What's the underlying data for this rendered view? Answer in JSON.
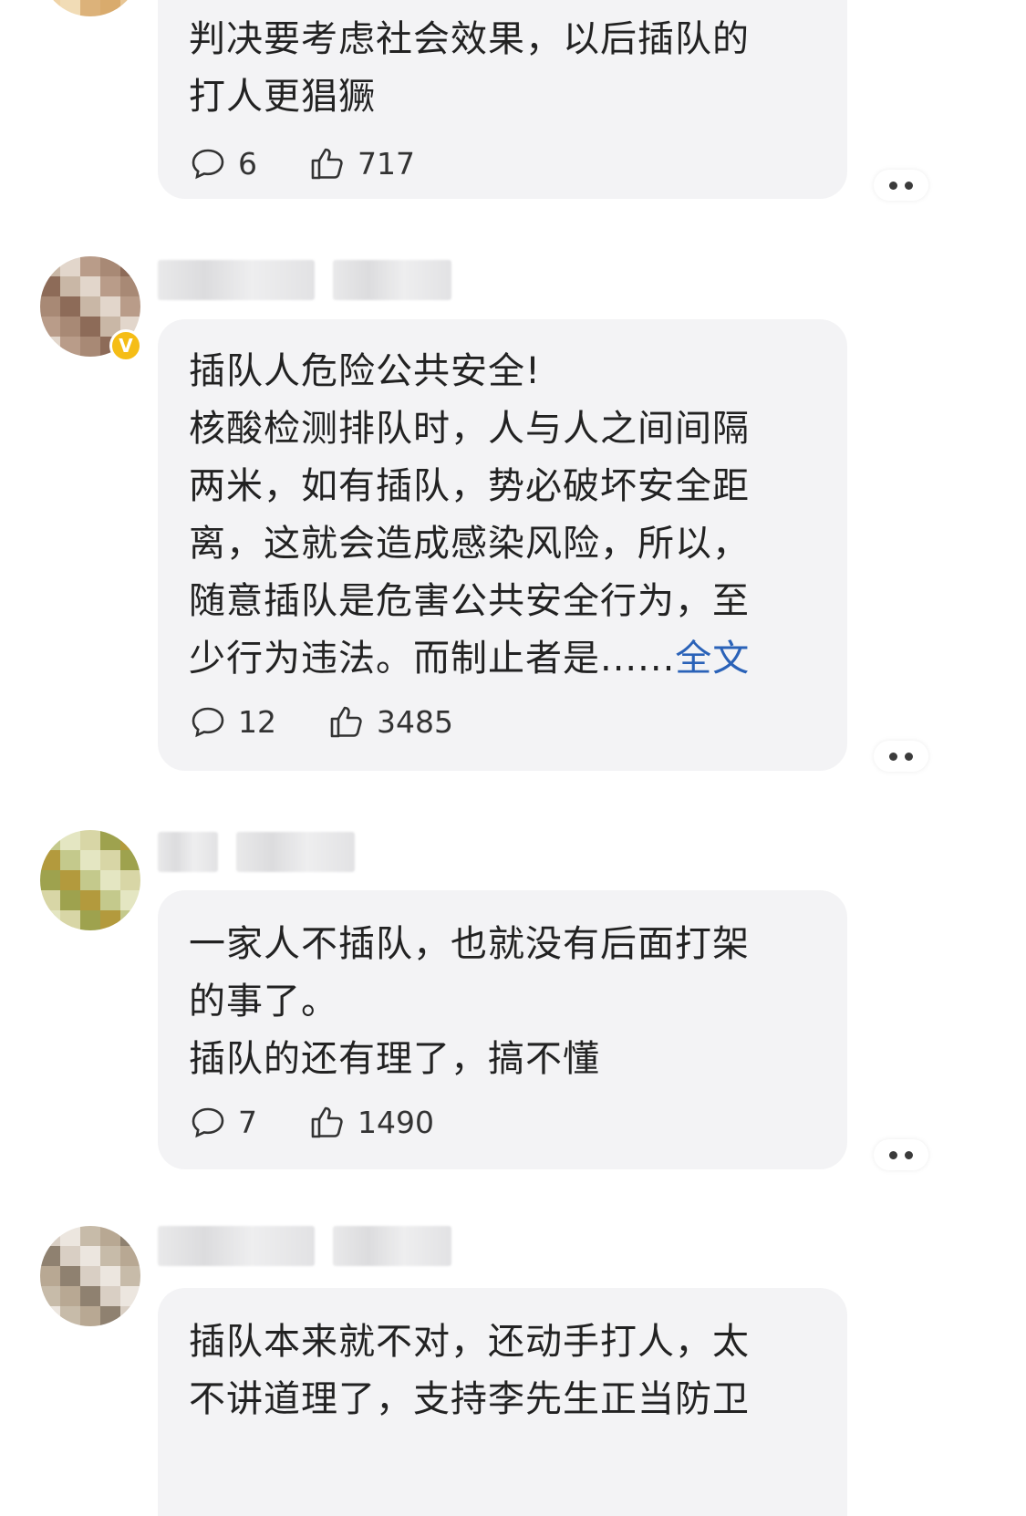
{
  "comments": [
    {
      "lines": [
        "判决要考虑社会效果，以后插队的",
        "打人更猖獗"
      ],
      "reply_count": "6",
      "like_count": "717",
      "verified": false,
      "avatar_palette": [
        "#e7c594",
        "#dcb27a",
        "#efd3a6",
        "#d9ab6d",
        "#f1dcb6"
      ]
    },
    {
      "lines": [
        "插队人危险公共安全!",
        "核酸检测排队时，人与人之间间隔",
        "两米，如有插队，势必破坏安全距",
        "离，这就会造成感染风险，所以，",
        "随意插队是危害公共安全行为，至"
      ],
      "last_line": "少行为违法。而制止者是......",
      "more_label": "全文",
      "reply_count": "12",
      "like_count": "3485",
      "verified": true,
      "badge_label": "V",
      "avatar_palette": [
        "#c9b7a6",
        "#a88975",
        "#e2d6cb",
        "#8d6b58",
        "#b99c89"
      ]
    },
    {
      "lines": [
        "一家人不插队，也就没有后面打架",
        "的事了。",
        "插队的还有理了，搞不懂"
      ],
      "reply_count": "7",
      "like_count": "1490",
      "verified": false,
      "avatar_palette": [
        "#c4c98c",
        "#9ea24e",
        "#e4e6c2",
        "#b39a3d",
        "#d8d6a6"
      ]
    },
    {
      "lines": [
        "插队本来就不对，还动手打人，太",
        "不讲道理了，支持李先生正当防卫"
      ],
      "verified": false,
      "avatar_palette": [
        "#d9cfc4",
        "#b8a893",
        "#ece6df",
        "#8f8170",
        "#c7bba9"
      ]
    }
  ],
  "colors": {
    "bubble_bg": "#f3f3f5",
    "link": "#2a62b8",
    "verified_badge": "#f5bd16",
    "username_blur": "#e2e2e4"
  },
  "icons": {
    "reply": "comment-bubble-icon",
    "like": "thumbs-up-icon",
    "more": "more-dots-icon"
  }
}
